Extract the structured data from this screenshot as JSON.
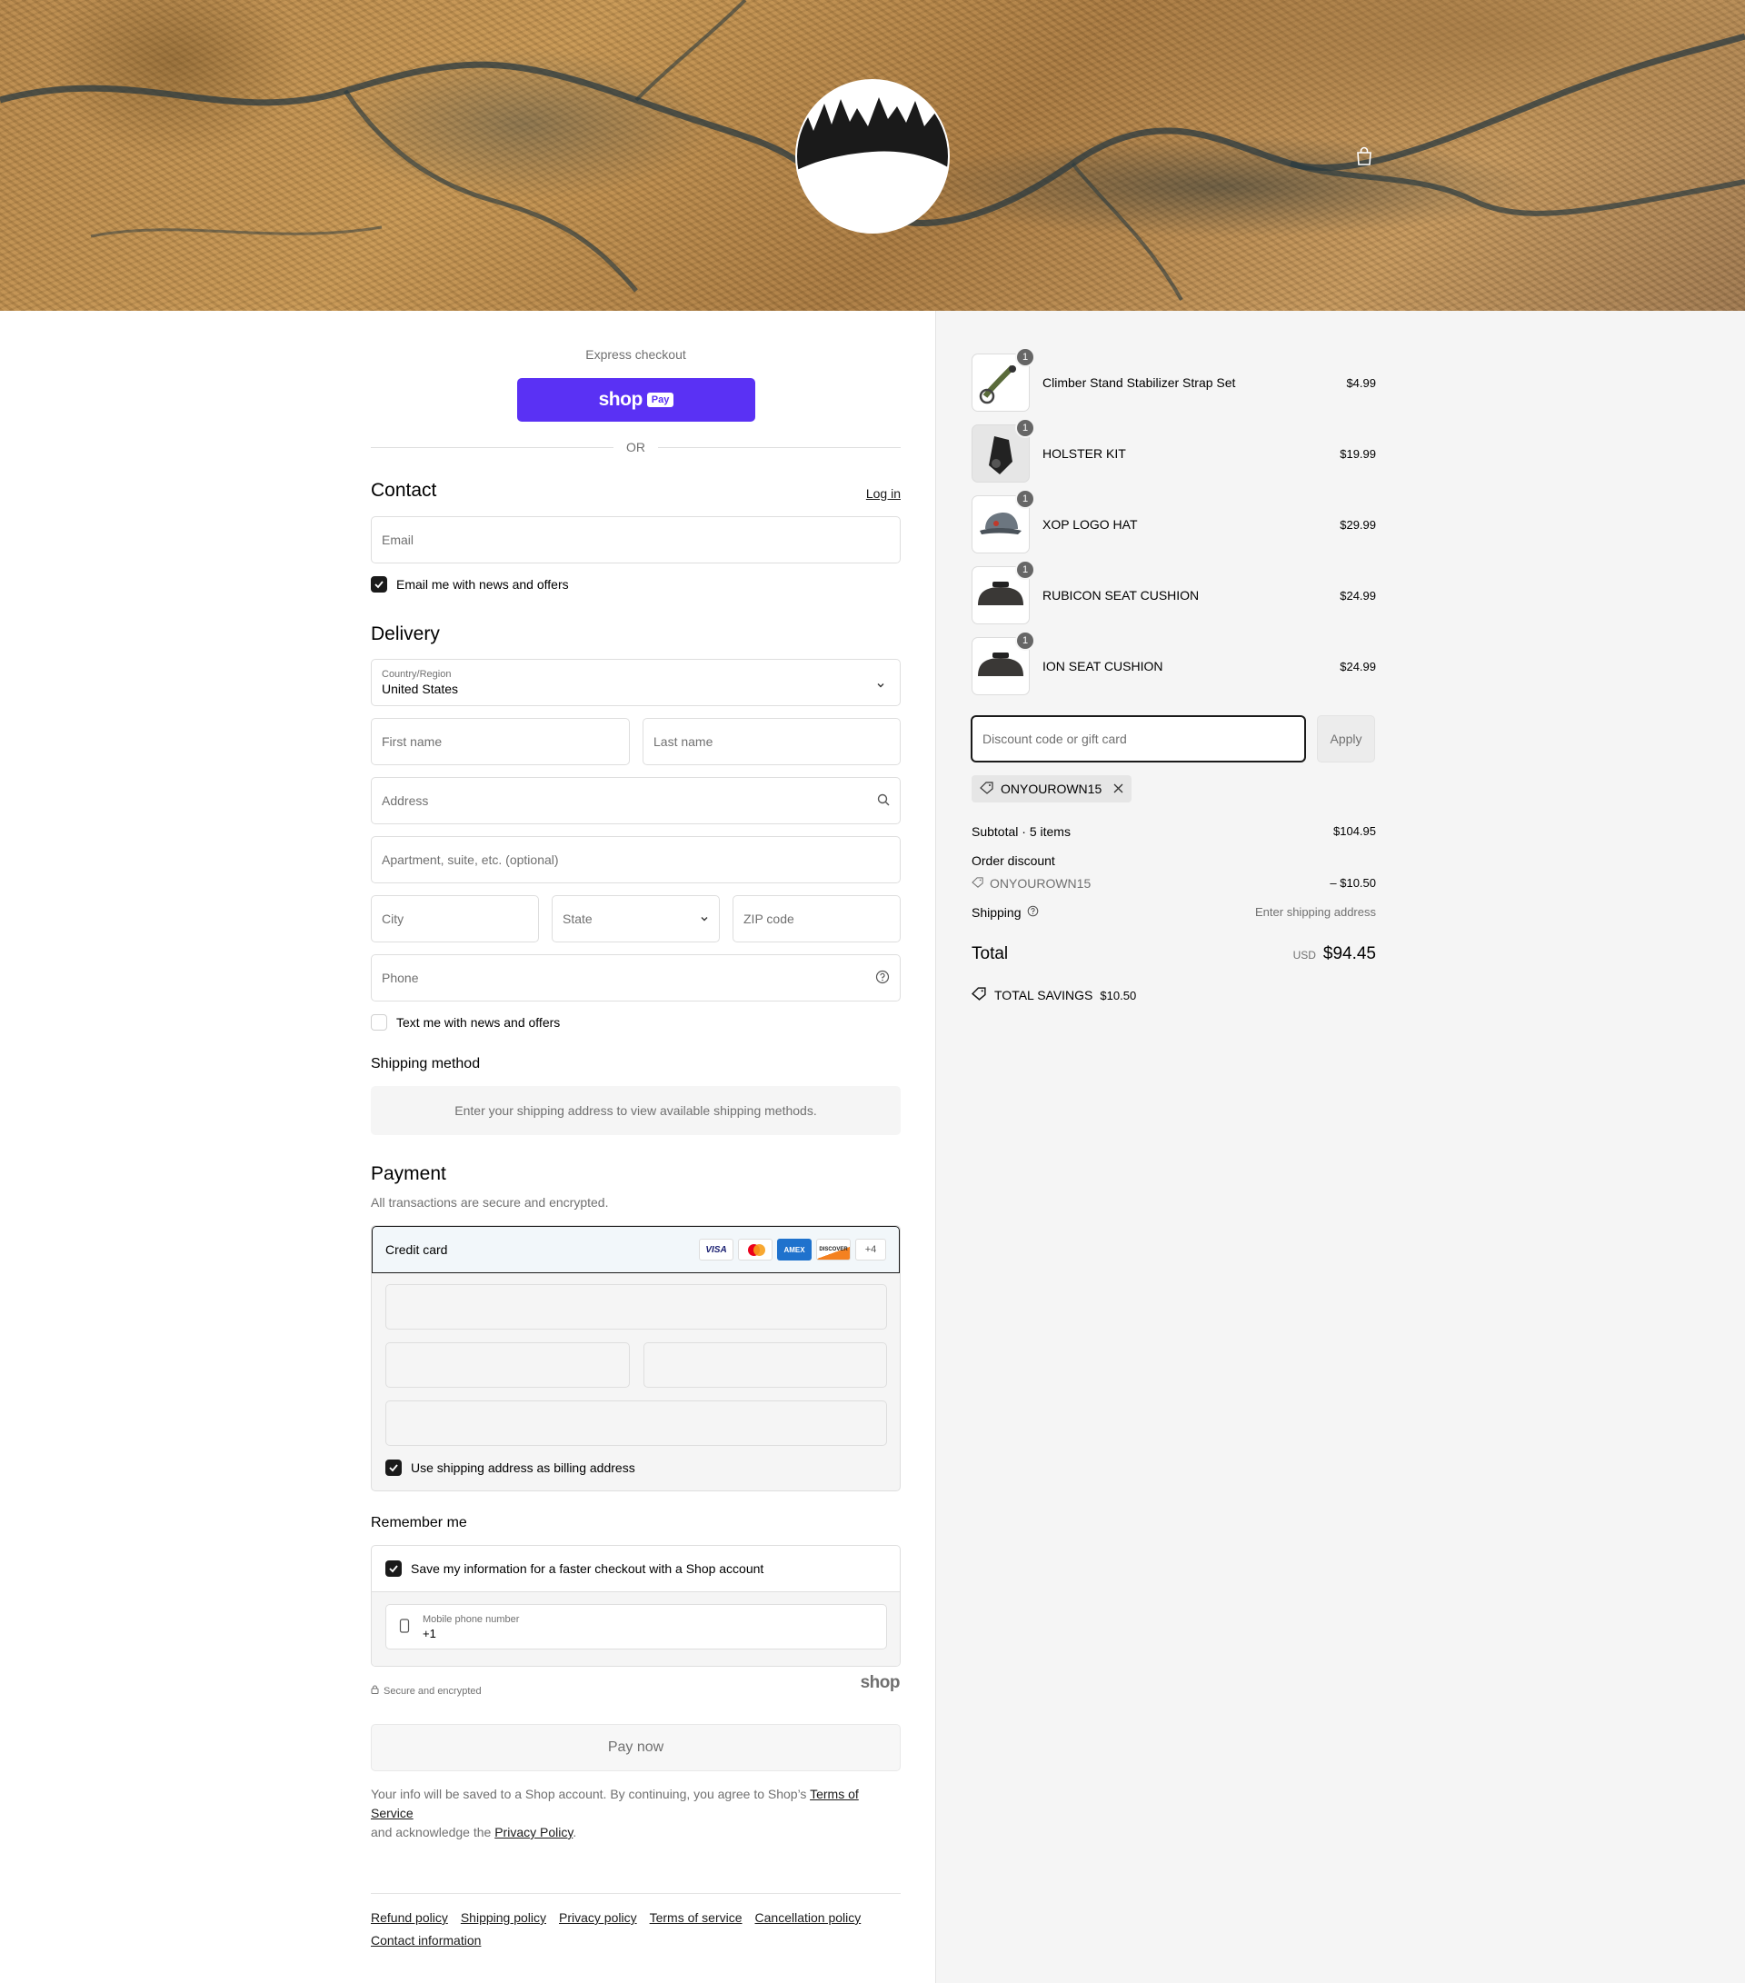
{
  "express": {
    "label": "Express checkout",
    "shop_pay_text": "shop",
    "pay_badge": "Pay",
    "or": "OR"
  },
  "contact": {
    "title": "Contact",
    "login": "Log in",
    "email_placeholder": "Email",
    "email_opt_in": "Email me with news and offers"
  },
  "delivery": {
    "title": "Delivery",
    "country_label": "Country/Region",
    "country_value": "United States",
    "first_name": "First name",
    "last_name": "Last name",
    "address": "Address",
    "apartment": "Apartment, suite, etc. (optional)",
    "city": "City",
    "state": "State",
    "zip": "ZIP code",
    "phone": "Phone",
    "sms_opt_in": "Text me with news and offers"
  },
  "shipping_method": {
    "title": "Shipping method",
    "message": "Enter your shipping address to view available shipping methods."
  },
  "payment": {
    "title": "Payment",
    "subtitle": "All transactions are secure and encrypted.",
    "method": "Credit card",
    "cards": [
      "VISA",
      "MC",
      "AMEX",
      "DISCOVER"
    ],
    "more": "+4",
    "billing_same": "Use shipping address as billing address"
  },
  "remember": {
    "title": "Remember me",
    "save_info": "Save my information for a faster checkout with a Shop account",
    "mobile_label": "Mobile phone number",
    "mobile_value": "+1",
    "secure": "Secure and encrypted",
    "shop_logo": "shop"
  },
  "pay_now": "Pay now",
  "legal": {
    "text_before": "Your info will be saved to a Shop account. By continuing, you agree to Shop’s ",
    "terms": "Terms of Service",
    "text_mid": "and acknowledge the ",
    "privacy": "Privacy Policy",
    "text_end": "."
  },
  "footer_links": [
    "Refund policy",
    "Shipping policy",
    "Privacy policy",
    "Terms of service",
    "Cancellation policy",
    "Contact information"
  ],
  "cart": {
    "items": [
      {
        "name": "Climber Stand Stabilizer Strap Set",
        "price": "$4.99",
        "qty": "1"
      },
      {
        "name": "HOLSTER KIT",
        "price": "$19.99",
        "qty": "1"
      },
      {
        "name": "XOP LOGO HAT",
        "price": "$29.99",
        "qty": "1"
      },
      {
        "name": "RUBICON SEAT CUSHION",
        "price": "$24.99",
        "qty": "1"
      },
      {
        "name": "ION SEAT CUSHION",
        "price": "$24.99",
        "qty": "1"
      }
    ],
    "discount_placeholder": "Discount code or gift card",
    "apply": "Apply",
    "applied_code": "ONYOUROWN15",
    "subtotal_label": "Subtotal · 5 items",
    "subtotal": "$104.95",
    "order_discount_label": "Order discount",
    "discount_code": "ONYOUROWN15",
    "discount_amount": "– $10.50",
    "shipping_label": "Shipping",
    "shipping_value": "Enter shipping address",
    "total_label": "Total",
    "currency": "USD",
    "total": "$94.45",
    "savings_label": "TOTAL SAVINGS",
    "savings": "$10.50"
  },
  "colors": {
    "shop_pay": "#5a31f4",
    "dark": "#1a1a1a",
    "panel": "#f5f5f5"
  }
}
